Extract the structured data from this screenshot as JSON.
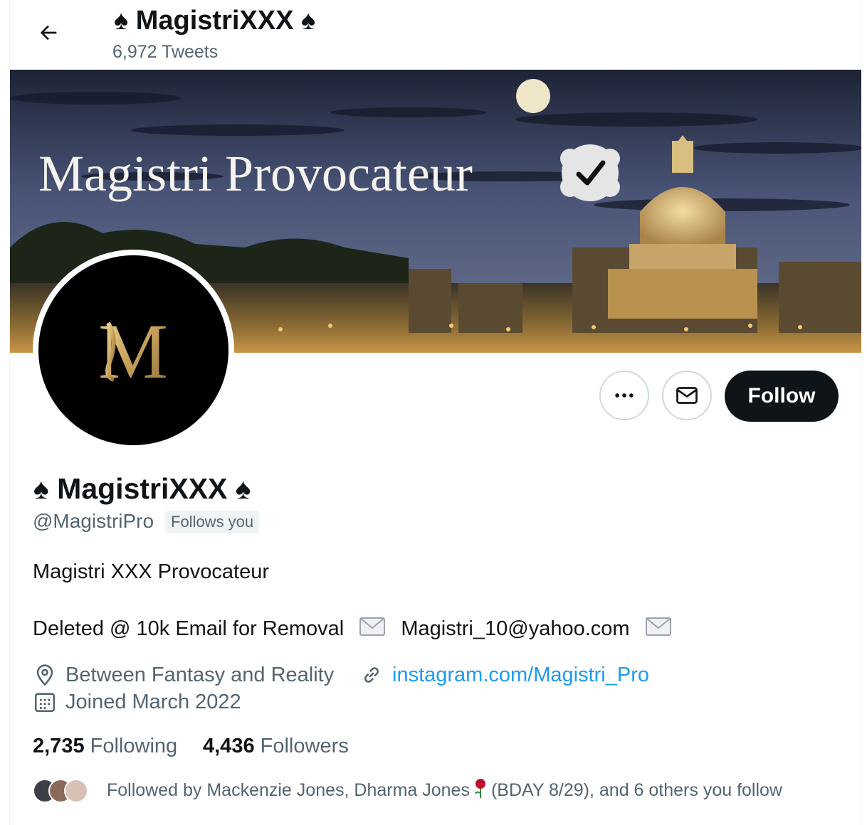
{
  "header": {
    "title": "♠ MagistriXXX ♠",
    "tweet_count": "6,972 Tweets"
  },
  "banner": {
    "text": "Magistri Provocateur"
  },
  "avatar": {
    "monogram": "M"
  },
  "actions": {
    "follow_label": "Follow"
  },
  "profile": {
    "display_name": "♠ MagistriXXX ♠",
    "handle": "@MagistriPro",
    "follows_you": "Follows you",
    "bio_line1": "Magistri XXX Provocateur",
    "bio_line2_a": "Deleted @ 10k  Email for Removal",
    "bio_line2_b": "Magistri_10@yahoo.com",
    "location": "Between Fantasy and Reality",
    "website": "instagram.com/Magistri_Pro",
    "joined": "Joined March 2022"
  },
  "stats": {
    "following_count": "2,735",
    "following_label": "Following",
    "followers_count": "4,436",
    "followers_label": "Followers"
  },
  "followed_by": {
    "prefix": "Followed by Mackenzie Jones, Dharma Jones",
    "suffix": "(BDAY 8/29), and 6 others you follow"
  },
  "icons": [
    "back-arrow-icon",
    "verified-badge-icon",
    "more-icon",
    "mail-icon",
    "location-icon",
    "link-icon",
    "calendar-icon",
    "envelope-emoji-icon",
    "rose-emoji-icon"
  ],
  "colors": {
    "link": "#1d9bf0",
    "text": "#0f1419",
    "secondary": "#536471",
    "button": "#0f1419"
  }
}
